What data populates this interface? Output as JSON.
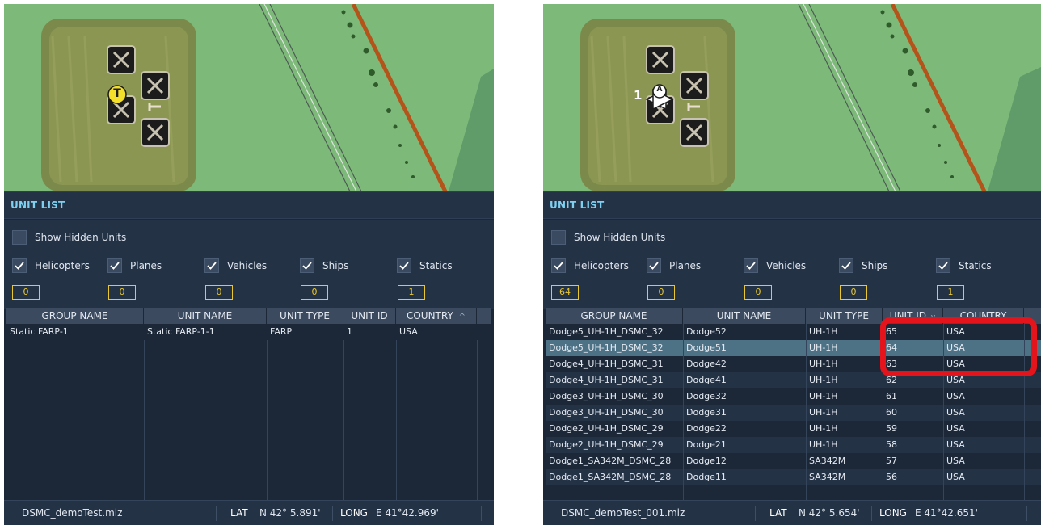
{
  "left": {
    "section_title": "UNIT LIST",
    "show_hidden_label": "Show Hidden Units",
    "filters": [
      {
        "label": "Helicopters",
        "checked": true,
        "count": "0"
      },
      {
        "label": "Planes",
        "checked": true,
        "count": "0"
      },
      {
        "label": "Vehicles",
        "checked": true,
        "count": "0"
      },
      {
        "label": "Ships",
        "checked": true,
        "count": "0"
      },
      {
        "label": "Statics",
        "checked": true,
        "count": "1"
      }
    ],
    "columns": [
      "GROUP NAME",
      "UNIT NAME",
      "UNIT TYPE",
      "UNIT ID",
      "COUNTRY"
    ],
    "sort_indicator": "^",
    "rows": [
      [
        "Static FARP-1",
        "Static FARP-1-1",
        "FARP",
        "1",
        "USA"
      ]
    ],
    "map_marker": "T",
    "status": {
      "file": "DSMC_demoTest.miz",
      "lat_label": "LAT",
      "lat": "N 42° 5.891'",
      "long_label": "LONG",
      "long": "E 41°42.969'"
    }
  },
  "right": {
    "section_title": "UNIT LIST",
    "show_hidden_label": "Show Hidden Units",
    "filters": [
      {
        "label": "Helicopters",
        "checked": true,
        "count": "64"
      },
      {
        "label": "Planes",
        "checked": true,
        "count": "0"
      },
      {
        "label": "Vehicles",
        "checked": true,
        "count": "0"
      },
      {
        "label": "Ships",
        "checked": true,
        "count": "0"
      },
      {
        "label": "Statics",
        "checked": true,
        "count": "1"
      }
    ],
    "columns": [
      "GROUP NAME",
      "UNIT NAME",
      "UNIT TYPE",
      "UNIT ID",
      "COUNTRY"
    ],
    "sort_indicator": "v",
    "rows": [
      [
        "Dodge5_UH-1H_DSMC_32",
        "Dodge52",
        "UH-1H",
        "65",
        "USA"
      ],
      [
        "Dodge5_UH-1H_DSMC_32",
        "Dodge51",
        "UH-1H",
        "64",
        "USA"
      ],
      [
        "Dodge4_UH-1H_DSMC_31",
        "Dodge42",
        "UH-1H",
        "63",
        "USA"
      ],
      [
        "Dodge4_UH-1H_DSMC_31",
        "Dodge41",
        "UH-1H",
        "62",
        "USA"
      ],
      [
        "Dodge3_UH-1H_DSMC_30",
        "Dodge32",
        "UH-1H",
        "61",
        "USA"
      ],
      [
        "Dodge3_UH-1H_DSMC_30",
        "Dodge31",
        "UH-1H",
        "60",
        "USA"
      ],
      [
        "Dodge2_UH-1H_DSMC_29",
        "Dodge22",
        "UH-1H",
        "59",
        "USA"
      ],
      [
        "Dodge2_UH-1H_DSMC_29",
        "Dodge21",
        "UH-1H",
        "58",
        "USA"
      ],
      [
        "Dodge1_SA342M_DSMC_28",
        "Dodge12",
        "SA342M",
        "57",
        "USA"
      ],
      [
        "Dodge1_SA342M_DSMC_28",
        "Dodge11",
        "SA342M",
        "56",
        "USA"
      ]
    ],
    "selected_row": 1,
    "map_marker_number": "1",
    "map_marker": "A",
    "status": {
      "file": "DSMC_demoTest_001.miz",
      "lat_label": "LAT",
      "lat": "N 42° 5.654'",
      "long_label": "LONG",
      "long": "E 41°42.651'"
    }
  },
  "colors": {
    "accent_title": "#7fd0f0",
    "count_border": "#e8c733",
    "highlight": "#e4141c",
    "selected_row": "#4d7286"
  }
}
